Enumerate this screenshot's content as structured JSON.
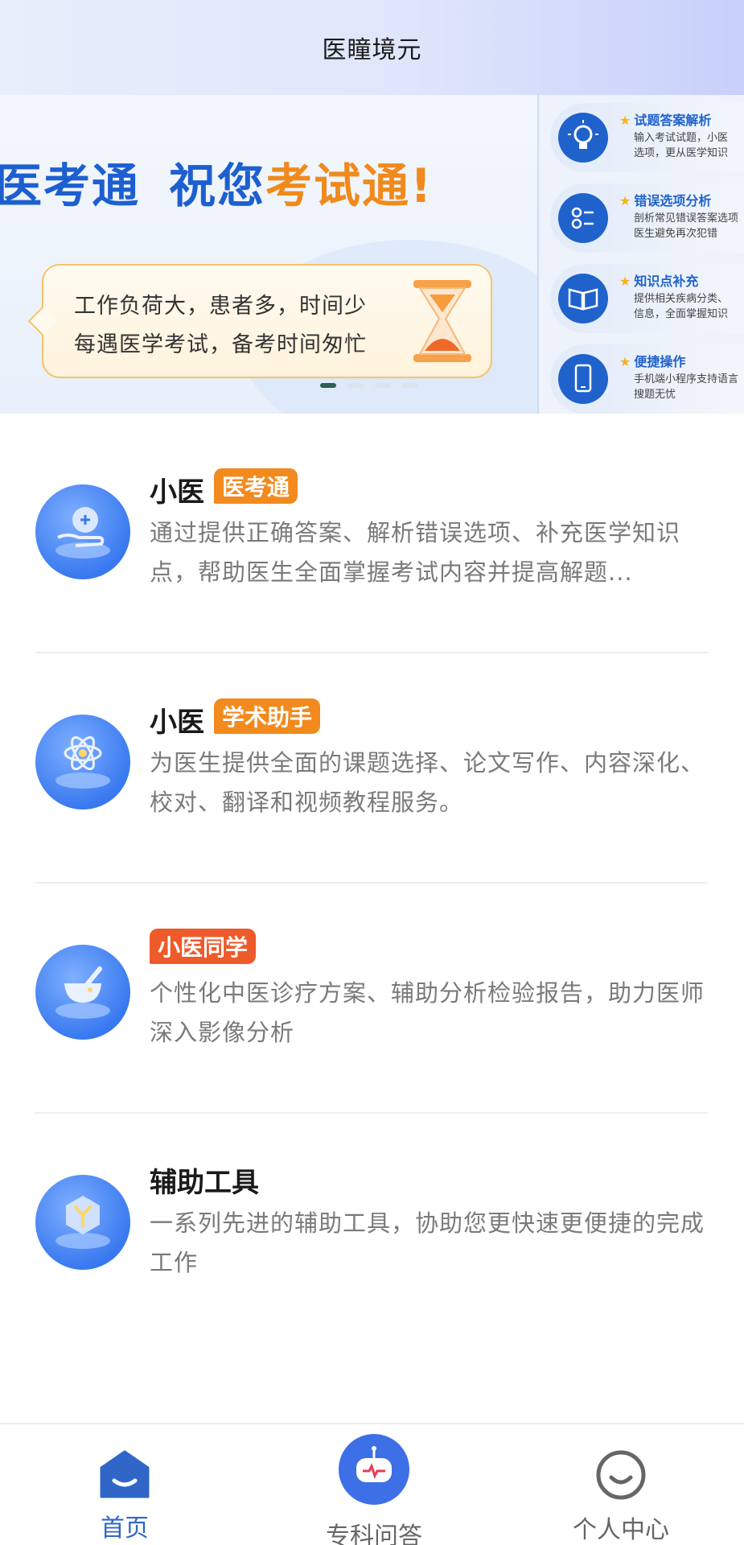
{
  "header": {
    "title": "医瞳境元"
  },
  "banner": {
    "headline_part1": "医考通",
    "headline_part2": "祝您",
    "headline_part3": "考试通!",
    "bubble_line1": "工作负荷大，患者多，时间少",
    "bubble_line2": "每遇医学考试，备考时间匆忙",
    "carousel_active_index": 0,
    "carousel_count": 4,
    "features": [
      {
        "title": "试题答案解析",
        "desc_line1": "输入考试试题，小医",
        "desc_line2": "选项，更从医学知识",
        "icon": "lightbulb-icon"
      },
      {
        "title": "错误选项分析",
        "desc_line1": "剖析常见错误答案选项",
        "desc_line2": "医生避免再次犯错",
        "icon": "checklist-icon"
      },
      {
        "title": "知识点补充",
        "desc_line1": "提供相关疾病分类、",
        "desc_line2": "信息，全面掌握知识",
        "icon": "book-icon"
      },
      {
        "title": "便捷操作",
        "desc_line1": "手机端小程序支持语言",
        "desc_line2": "搜题无忧",
        "icon": "phone-icon"
      }
    ]
  },
  "services": [
    {
      "prefix": "小医",
      "badge": "医考通",
      "badge_color": "#f28a1e",
      "description": "通过提供正确答案、解析错误选项、补充医学知识点，帮助医生全面掌握考试内容并提高解题...",
      "icon": "medical-hand-icon"
    },
    {
      "prefix": "小医",
      "badge": "学术助手",
      "badge_color": "#f28a1e",
      "description": "为医生提供全面的课题选择、论文写作、内容深化、校对、翻译和视频教程服务。",
      "icon": "atom-icon"
    },
    {
      "prefix": "",
      "badge": "小医同学",
      "badge_color": "#ee5a2a",
      "description": "个性化中医诊疗方案、辅助分析检验报告，助力医师深入影像分析",
      "icon": "mortar-pestle-icon"
    },
    {
      "prefix": "辅助工具",
      "badge": "",
      "badge_color": "",
      "description": "一系列先进的辅助工具，协助您更快速更便捷的完成工作",
      "icon": "cube-tool-icon"
    }
  ],
  "tabs": {
    "home": "首页",
    "qa": "专科问答",
    "profile": "个人中心"
  },
  "colors": {
    "accent": "#2f66c8",
    "orange": "#f28a1e"
  }
}
